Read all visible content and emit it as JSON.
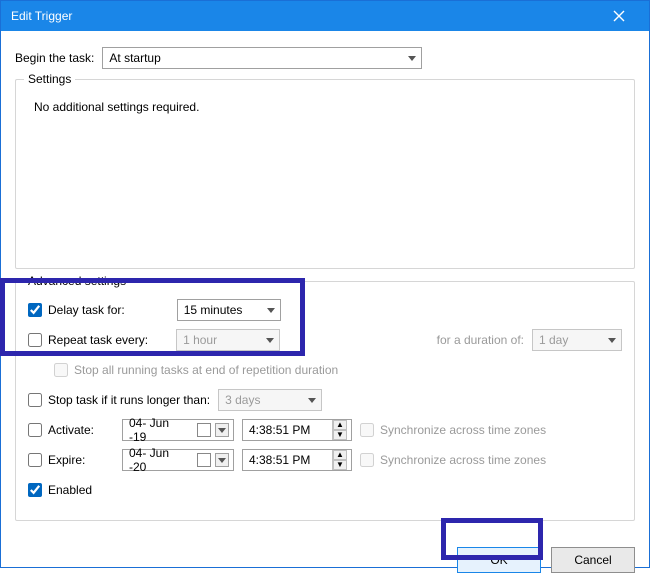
{
  "window": {
    "title": "Edit Trigger"
  },
  "begin": {
    "label": "Begin the task:",
    "value": "At startup"
  },
  "settings": {
    "legend": "Settings",
    "no_additional": "No additional settings required."
  },
  "advanced": {
    "legend": "Advanced settings",
    "delay": {
      "label": "Delay task for:",
      "checked": true,
      "value": "15 minutes"
    },
    "repeat": {
      "label": "Repeat task every:",
      "checked": false,
      "value": "1 hour",
      "duration_label": "for a duration of:",
      "duration_value": "1 day"
    },
    "stop_repetition": {
      "label": "Stop all running tasks at end of repetition duration",
      "checked": false
    },
    "stop_longer": {
      "label": "Stop task if it runs longer than:",
      "checked": false,
      "value": "3 days"
    },
    "activate": {
      "label": "Activate:",
      "checked": false,
      "date": "04- Jun -19",
      "time": "4:38:51 PM",
      "sync_label": "Synchronize across time zones",
      "sync_checked": false
    },
    "expire": {
      "label": "Expire:",
      "checked": false,
      "date": "04- Jun -20",
      "time": "4:38:51 PM",
      "sync_label": "Synchronize across time zones",
      "sync_checked": false
    },
    "enabled": {
      "label": "Enabled",
      "checked": true
    }
  },
  "footer": {
    "ok": "OK",
    "cancel": "Cancel"
  }
}
